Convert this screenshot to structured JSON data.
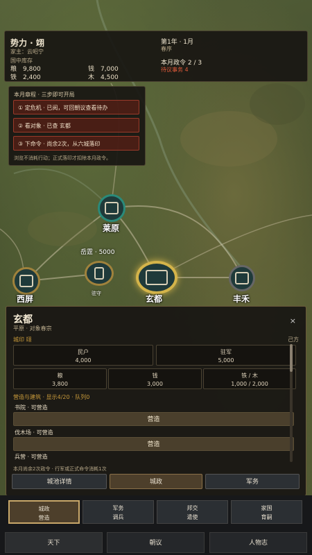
{
  "status": {
    "faction": "势力 · 翊",
    "lord": "家主：云昭宁",
    "stock_label": "国中库存",
    "resources": [
      {
        "name": "粮",
        "value": "9,800"
      },
      {
        "name": "钱",
        "value": "7,000"
      },
      {
        "name": "铁",
        "value": "2,400"
      },
      {
        "name": "木",
        "value": "4,500"
      }
    ],
    "date": "第1年 · 1月",
    "season": "春序",
    "orders": "本月政令  2 / 3",
    "pending": "待议事务  4"
  },
  "tutorial": {
    "title": "本月章程 · 三步即可开局",
    "steps": [
      "① 定危机 · 已阅，可回朝议查看待办",
      "② 看对象 · 已查 玄都",
      "③ 下命令 · 尚余2次，从六城落印"
    ],
    "note": "浏览不消耗行动；正式落印才扣除本月政令。"
  },
  "map": {
    "cities": [
      {
        "name": "西屏"
      },
      {
        "name": "莱原"
      },
      {
        "name": "玄都"
      },
      {
        "name": "丰禾"
      }
    ],
    "army_label": "岳霆 · 5000",
    "army_sub": "驻守"
  },
  "city_panel": {
    "name": "玄都",
    "desc": "平原 · 对象春宗",
    "seal": "城印  翊",
    "owner": "己方",
    "close": "×",
    "stats": [
      {
        "label": "民户",
        "value": "4,000"
      },
      {
        "label": "驻军",
        "value": "5,000"
      },
      {
        "label": "粮",
        "value": "3,800"
      },
      {
        "label": "钱",
        "value": "3,000"
      },
      {
        "label": "铁 / 木",
        "value": "1,000 / 2,000"
      }
    ],
    "build_header": "营造与建筑 · 显示4/20 · 队列0",
    "buildings": [
      {
        "name": "书院 · 可营造",
        "button": "营造"
      },
      {
        "name": "伐木场 · 可营造",
        "button": "营造"
      },
      {
        "name": "兵营 · 可营造",
        "button": ""
      }
    ],
    "footer_note": "本月尚余2次政令 · 行军或正式命令消耗1次",
    "actions": [
      "城池详情",
      "城政",
      "军务"
    ]
  },
  "commands": [
    {
      "line1": "城政",
      "line2": "营造"
    },
    {
      "line1": "军务",
      "line2": "调兵"
    },
    {
      "line1": "邦交",
      "line2": "遣使"
    },
    {
      "line1": "家国",
      "line2": "育嗣"
    }
  ],
  "nav": [
    "天下",
    "朝议",
    "人物志"
  ],
  "colors": {
    "accent": "#c9a86a",
    "alert": "#e05a3a",
    "seal": "#c89a3a"
  }
}
